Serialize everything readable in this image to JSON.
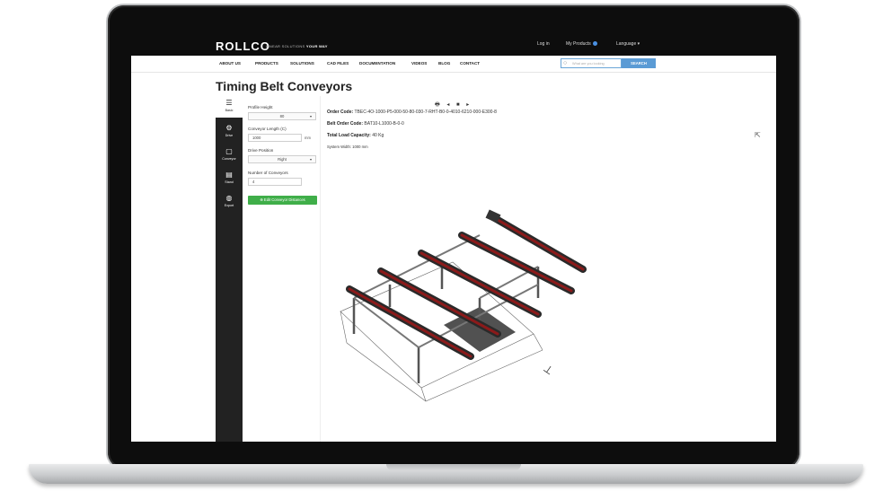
{
  "header": {
    "logo": "ROLLCO",
    "tagline_pre": "LINEAR SOLUTIONS ",
    "tagline_em": "YOUR WAY",
    "login": "Log in",
    "my_products": "My Products",
    "language": "Language ▾"
  },
  "nav": {
    "items": [
      "ABOUT US",
      "PRODUCTS",
      "SOLUTIONS",
      "CAD FILES",
      "DOCUMENTATION",
      "VIDEOS",
      "BLOG",
      "CONTACT"
    ],
    "search_placeholder": "What are you looking",
    "search_button": "SEARCH"
  },
  "page": {
    "title": "Timing Belt Conveyors"
  },
  "sidebar": {
    "items": [
      {
        "label": "Basic",
        "icon": "list-icon"
      },
      {
        "label": "Drive",
        "icon": "gear-icon"
      },
      {
        "label": "Conveyor",
        "icon": "box-icon"
      },
      {
        "label": "Stand",
        "icon": "stand-icon"
      },
      {
        "label": "Export",
        "icon": "export-icon"
      }
    ]
  },
  "config": {
    "profile_height_label": "Profile Height",
    "profile_height_value": "80",
    "conveyor_length_label": "Conveyor Length (C)",
    "conveyor_length_value": "1000",
    "conveyor_length_unit": "mm",
    "drive_position_label": "Drive Position",
    "drive_position_value": "Right",
    "num_conveyors_label": "Number of Conveyors",
    "num_conveyors_value": "4",
    "edit_button": "⊕ Edit Conveyor Distances"
  },
  "order": {
    "tool_icons": "🖶 ◂ ■ ▸",
    "order_code_label": "Order Code:",
    "order_code_value": "TBEC-4O-1000-P5-000-50-80-030-7-RHT-B0-0-4010-6210-000-E300-8",
    "belt_order_label": "Belt Order Code:",
    "belt_order_value": "BAT10-L1000-B-0-0",
    "load_label": "Total Load Capacity:",
    "load_value": "40 Kg",
    "width_label": "System Width:",
    "width_value": "1000 mm"
  },
  "colors": {
    "screen_bezel": "#0d0d0d",
    "accent_blue": "#5b9bd5",
    "accent_green": "#3fae49",
    "belt_red": "#8b1a1a"
  }
}
